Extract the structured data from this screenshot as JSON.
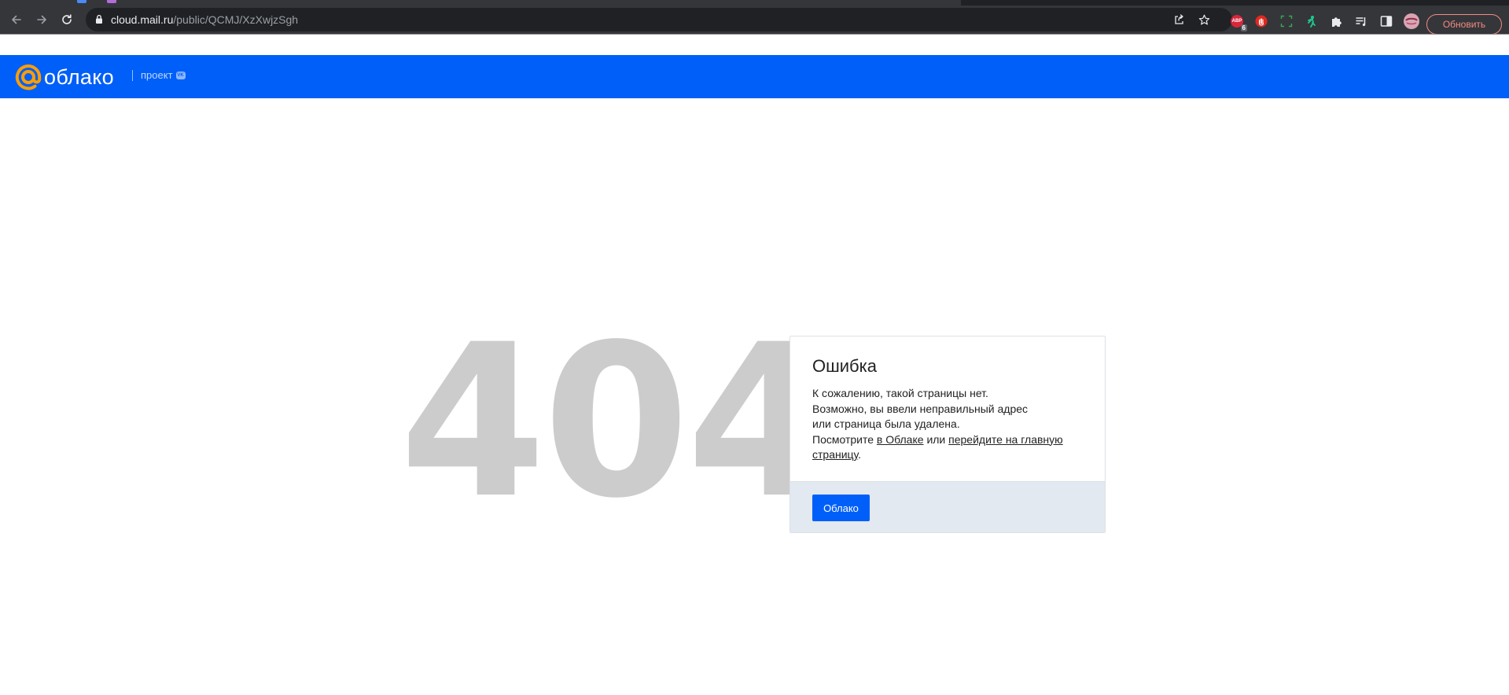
{
  "browser": {
    "url_host": "cloud.mail.ru",
    "url_path": "/public/QCMJ/XzXwjzSgh",
    "update_button_label": "Обновить",
    "extensions": [
      {
        "name": "adblock-icon",
        "label": "ABP",
        "badge": "6"
      },
      {
        "name": "stop-hand-icon"
      },
      {
        "name": "screenshot-icon"
      },
      {
        "name": "figure-icon"
      },
      {
        "name": "puzzle-extensions-icon"
      },
      {
        "name": "reading-list-icon"
      },
      {
        "name": "side-panel-icon"
      },
      {
        "name": "profile-avatar"
      }
    ],
    "colors": {
      "toolbar": "#35363a",
      "update_accent": "#f28b82"
    }
  },
  "header": {
    "logo_text": "облако",
    "project_label": "проект",
    "project_badge": "VK",
    "colors": {
      "background": "#005ff9",
      "logo_at": "#ff9e00"
    }
  },
  "error": {
    "code": "404",
    "title": "Ошибка",
    "line1": "К сожалению, такой страницы нет.",
    "line2": "Возможно, вы ввели неправильный адрес",
    "line3": "или страница была удалена.",
    "line4_prefix": "Посмотрите",
    "link_cloud": "в Облаке",
    "line4_middle": "или",
    "link_home": "перейдите на главную страницу",
    "line4_suffix": ".",
    "button_label": "Облако"
  }
}
